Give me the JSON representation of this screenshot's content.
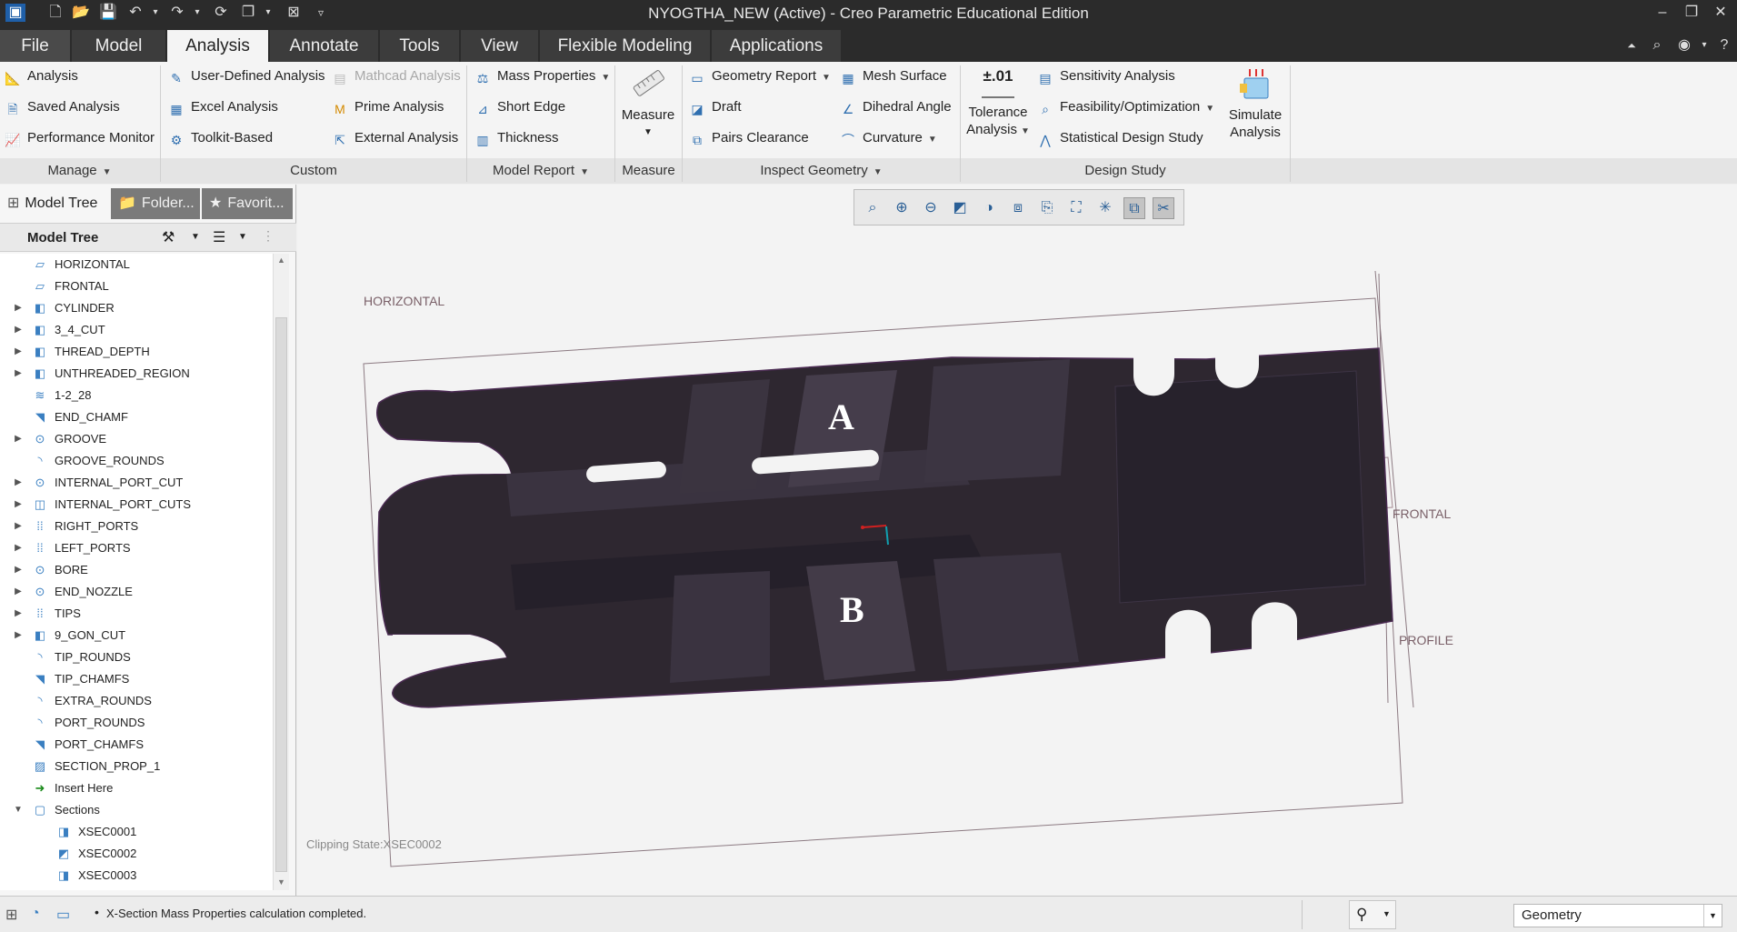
{
  "window": {
    "title": "NYOGTHA_NEW (Active) - Creo Parametric Educational Edition"
  },
  "menu": {
    "tabs": [
      "File",
      "Model",
      "Analysis",
      "Annotate",
      "Tools",
      "View",
      "Flexible Modeling",
      "Applications"
    ],
    "active": "Analysis"
  },
  "ribbon": {
    "manage": {
      "items": [
        "Analysis",
        "Saved Analysis",
        "Performance Monitor"
      ],
      "label": "Manage"
    },
    "custom": {
      "items": [
        "User-Defined Analysis",
        "Excel Analysis",
        "Toolkit-Based",
        "Mathcad Analysis",
        "Prime Analysis",
        "External Analysis"
      ],
      "label": "Custom"
    },
    "model_report": {
      "items": [
        "Mass Properties",
        "Short Edge",
        "Thickness"
      ],
      "label": "Model Report"
    },
    "measure": {
      "button": "Measure",
      "label": "Measure"
    },
    "inspect_geometry": {
      "items": [
        "Geometry Report",
        "Draft",
        "Pairs Clearance",
        "Mesh Surface",
        "Dihedral Angle",
        "Curvature"
      ],
      "label": "Inspect Geometry"
    },
    "design_study": {
      "tolerance_icon_text": "±.01",
      "tolerance_line1": "Tolerance",
      "tolerance_line2": "Analysis",
      "items": [
        "Sensitivity Analysis",
        "Feasibility/Optimization",
        "Statistical Design Study"
      ],
      "simulate_line1": "Simulate",
      "simulate_line2": "Analysis",
      "label": "Design Study"
    }
  },
  "left_panel": {
    "tabs": [
      "Model Tree",
      "Folder...",
      "Favorit..."
    ],
    "header": "Model Tree",
    "tree": [
      {
        "label": "HORIZONTAL",
        "icon": "datum-plane-icon",
        "expand": false
      },
      {
        "label": "FRONTAL",
        "icon": "datum-plane-icon",
        "expand": false
      },
      {
        "label": "CYLINDER",
        "icon": "extrude-icon",
        "expand": true
      },
      {
        "label": "3_4_CUT",
        "icon": "extrude-icon",
        "expand": true
      },
      {
        "label": "THREAD_DEPTH",
        "icon": "extrude-icon",
        "expand": true
      },
      {
        "label": "UNTHREADED_REGION",
        "icon": "extrude-icon",
        "expand": true
      },
      {
        "label": "1-2_28",
        "icon": "thread-icon",
        "expand": false
      },
      {
        "label": "END_CHAMF",
        "icon": "chamfer-icon",
        "expand": false
      },
      {
        "label": "GROOVE",
        "icon": "revolve-icon",
        "expand": true
      },
      {
        "label": "GROOVE_ROUNDS",
        "icon": "round-icon",
        "expand": false
      },
      {
        "label": "INTERNAL_PORT_CUT",
        "icon": "revolve-icon",
        "expand": true
      },
      {
        "label": "INTERNAL_PORT_CUTS",
        "icon": "mirror-icon",
        "expand": true
      },
      {
        "label": "RIGHT_PORTS",
        "icon": "pattern-icon",
        "expand": true
      },
      {
        "label": "LEFT_PORTS",
        "icon": "pattern-icon",
        "expand": true
      },
      {
        "label": "BORE",
        "icon": "revolve-icon",
        "expand": true
      },
      {
        "label": "END_NOZZLE",
        "icon": "revolve-icon",
        "expand": true
      },
      {
        "label": "TIPS",
        "icon": "pattern-icon",
        "expand": true
      },
      {
        "label": "9_GON_CUT",
        "icon": "extrude-icon",
        "expand": true
      },
      {
        "label": "TIP_ROUNDS",
        "icon": "round-icon",
        "expand": false
      },
      {
        "label": "TIP_CHAMFS",
        "icon": "chamfer-icon",
        "expand": false
      },
      {
        "label": "EXTRA_ROUNDS",
        "icon": "round-icon",
        "expand": false
      },
      {
        "label": "PORT_ROUNDS",
        "icon": "round-icon",
        "expand": false
      },
      {
        "label": "PORT_CHAMFS",
        "icon": "chamfer-icon",
        "expand": false
      },
      {
        "label": "SECTION_PROP_1",
        "icon": "analysis-feature-icon",
        "expand": false
      },
      {
        "label": "Insert Here",
        "icon": "insert-arrow-icon",
        "expand": false
      },
      {
        "label": "Sections",
        "icon": "sections-folder-icon",
        "expand": "open"
      },
      {
        "label": "XSEC0001",
        "icon": "section-icon",
        "expand": false,
        "child": true
      },
      {
        "label": "XSEC0002",
        "icon": "section-active-icon",
        "expand": false,
        "child": true
      },
      {
        "label": "XSEC0003",
        "icon": "section-icon",
        "expand": false,
        "child": true
      }
    ]
  },
  "viewport": {
    "labels": {
      "horizontal": "HORIZONTAL",
      "frontal": "FRONTAL",
      "profile": "PROFILE",
      "a": "A",
      "b": "B"
    },
    "clipping_state": "Clipping State:XSEC0002"
  },
  "status": {
    "message": "X-Section Mass Properties calculation completed.",
    "filter": "Geometry"
  },
  "colors": {
    "accent_blue": "#2f6fb0",
    "model_body": "#2e2730",
    "dark_chrome": "#2b2b2b"
  }
}
